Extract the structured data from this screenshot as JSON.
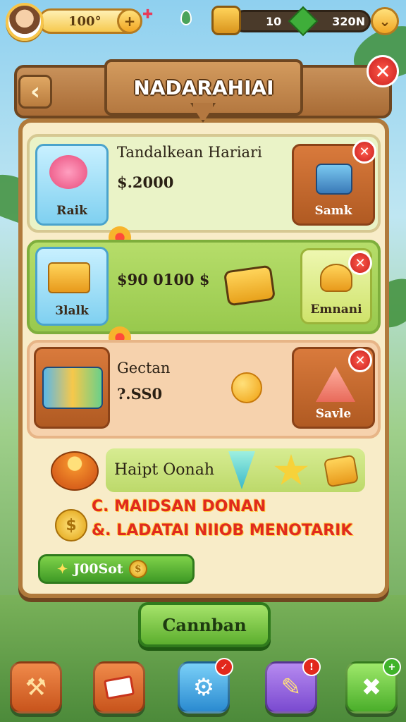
{
  "hud": {
    "level_value": "100°",
    "resource_amount": "10",
    "currency_amount": "320N"
  },
  "header": {
    "title": "NADARAHIAI"
  },
  "offers": [
    {
      "name": "Tandalkean Hariari",
      "price": "$.2000",
      "left_label": "Raik",
      "right_label": "Samk"
    },
    {
      "name": "",
      "price": "$90 0100 $",
      "left_label": "3lalk",
      "right_label": "Emnani"
    },
    {
      "name": "Gectan",
      "price": "?.SS0",
      "left_label": "",
      "right_label": "Savle"
    }
  ],
  "feature": {
    "label": "Haipt Oonah"
  },
  "info_lines": [
    "C. MAIDSAN DONAN",
    "&. LADATAI NIIOB MENOTARIK"
  ],
  "boost": {
    "label": "J00Sot"
  },
  "confirm_button": "Cannban",
  "icons": {
    "back": "chevron-left-icon",
    "close": "close-icon",
    "plus": "plus-icon",
    "coin": "coin-icon"
  },
  "colors": {
    "panel": "#f8ecc8",
    "wood": "#b07a3c",
    "green_row": "#98c94d",
    "peach_row": "#f6d2ad",
    "close_red": "#c81e1e",
    "confirm_green": "#5cae2e"
  }
}
